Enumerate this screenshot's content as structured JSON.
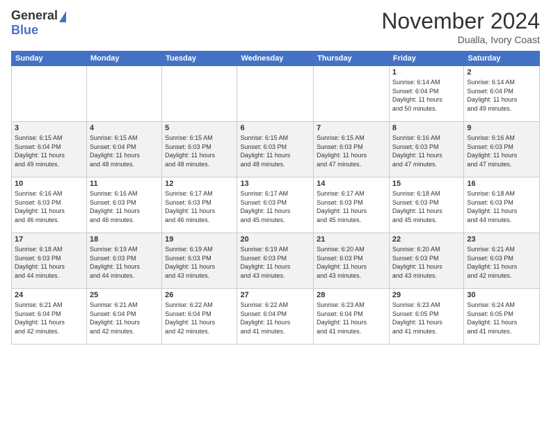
{
  "logo": {
    "general": "General",
    "blue": "Blue"
  },
  "header": {
    "month": "November 2024",
    "location": "Dualla, Ivory Coast"
  },
  "days_of_week": [
    "Sunday",
    "Monday",
    "Tuesday",
    "Wednesday",
    "Thursday",
    "Friday",
    "Saturday"
  ],
  "weeks": [
    [
      {
        "day": "",
        "info": ""
      },
      {
        "day": "",
        "info": ""
      },
      {
        "day": "",
        "info": ""
      },
      {
        "day": "",
        "info": ""
      },
      {
        "day": "",
        "info": ""
      },
      {
        "day": "1",
        "info": "Sunrise: 6:14 AM\nSunset: 6:04 PM\nDaylight: 11 hours\nand 50 minutes."
      },
      {
        "day": "2",
        "info": "Sunrise: 6:14 AM\nSunset: 6:04 PM\nDaylight: 11 hours\nand 49 minutes."
      }
    ],
    [
      {
        "day": "3",
        "info": "Sunrise: 6:15 AM\nSunset: 6:04 PM\nDaylight: 11 hours\nand 49 minutes."
      },
      {
        "day": "4",
        "info": "Sunrise: 6:15 AM\nSunset: 6:04 PM\nDaylight: 11 hours\nand 48 minutes."
      },
      {
        "day": "5",
        "info": "Sunrise: 6:15 AM\nSunset: 6:03 PM\nDaylight: 11 hours\nand 48 minutes."
      },
      {
        "day": "6",
        "info": "Sunrise: 6:15 AM\nSunset: 6:03 PM\nDaylight: 11 hours\nand 48 minutes."
      },
      {
        "day": "7",
        "info": "Sunrise: 6:15 AM\nSunset: 6:03 PM\nDaylight: 11 hours\nand 47 minutes."
      },
      {
        "day": "8",
        "info": "Sunrise: 6:16 AM\nSunset: 6:03 PM\nDaylight: 11 hours\nand 47 minutes."
      },
      {
        "day": "9",
        "info": "Sunrise: 6:16 AM\nSunset: 6:03 PM\nDaylight: 11 hours\nand 47 minutes."
      }
    ],
    [
      {
        "day": "10",
        "info": "Sunrise: 6:16 AM\nSunset: 6:03 PM\nDaylight: 11 hours\nand 46 minutes."
      },
      {
        "day": "11",
        "info": "Sunrise: 6:16 AM\nSunset: 6:03 PM\nDaylight: 11 hours\nand 46 minutes."
      },
      {
        "day": "12",
        "info": "Sunrise: 6:17 AM\nSunset: 6:03 PM\nDaylight: 11 hours\nand 46 minutes."
      },
      {
        "day": "13",
        "info": "Sunrise: 6:17 AM\nSunset: 6:03 PM\nDaylight: 11 hours\nand 45 minutes."
      },
      {
        "day": "14",
        "info": "Sunrise: 6:17 AM\nSunset: 6:03 PM\nDaylight: 11 hours\nand 45 minutes."
      },
      {
        "day": "15",
        "info": "Sunrise: 6:18 AM\nSunset: 6:03 PM\nDaylight: 11 hours\nand 45 minutes."
      },
      {
        "day": "16",
        "info": "Sunrise: 6:18 AM\nSunset: 6:03 PM\nDaylight: 11 hours\nand 44 minutes."
      }
    ],
    [
      {
        "day": "17",
        "info": "Sunrise: 6:18 AM\nSunset: 6:03 PM\nDaylight: 11 hours\nand 44 minutes."
      },
      {
        "day": "18",
        "info": "Sunrise: 6:19 AM\nSunset: 6:03 PM\nDaylight: 11 hours\nand 44 minutes."
      },
      {
        "day": "19",
        "info": "Sunrise: 6:19 AM\nSunset: 6:03 PM\nDaylight: 11 hours\nand 43 minutes."
      },
      {
        "day": "20",
        "info": "Sunrise: 6:19 AM\nSunset: 6:03 PM\nDaylight: 11 hours\nand 43 minutes."
      },
      {
        "day": "21",
        "info": "Sunrise: 6:20 AM\nSunset: 6:03 PM\nDaylight: 11 hours\nand 43 minutes."
      },
      {
        "day": "22",
        "info": "Sunrise: 6:20 AM\nSunset: 6:03 PM\nDaylight: 11 hours\nand 43 minutes."
      },
      {
        "day": "23",
        "info": "Sunrise: 6:21 AM\nSunset: 6:03 PM\nDaylight: 11 hours\nand 42 minutes."
      }
    ],
    [
      {
        "day": "24",
        "info": "Sunrise: 6:21 AM\nSunset: 6:04 PM\nDaylight: 11 hours\nand 42 minutes."
      },
      {
        "day": "25",
        "info": "Sunrise: 6:21 AM\nSunset: 6:04 PM\nDaylight: 11 hours\nand 42 minutes."
      },
      {
        "day": "26",
        "info": "Sunrise: 6:22 AM\nSunset: 6:04 PM\nDaylight: 11 hours\nand 42 minutes."
      },
      {
        "day": "27",
        "info": "Sunrise: 6:22 AM\nSunset: 6:04 PM\nDaylight: 11 hours\nand 41 minutes."
      },
      {
        "day": "28",
        "info": "Sunrise: 6:23 AM\nSunset: 6:04 PM\nDaylight: 11 hours\nand 41 minutes."
      },
      {
        "day": "29",
        "info": "Sunrise: 6:23 AM\nSunset: 6:05 PM\nDaylight: 11 hours\nand 41 minutes."
      },
      {
        "day": "30",
        "info": "Sunrise: 6:24 AM\nSunset: 6:05 PM\nDaylight: 11 hours\nand 41 minutes."
      }
    ]
  ]
}
